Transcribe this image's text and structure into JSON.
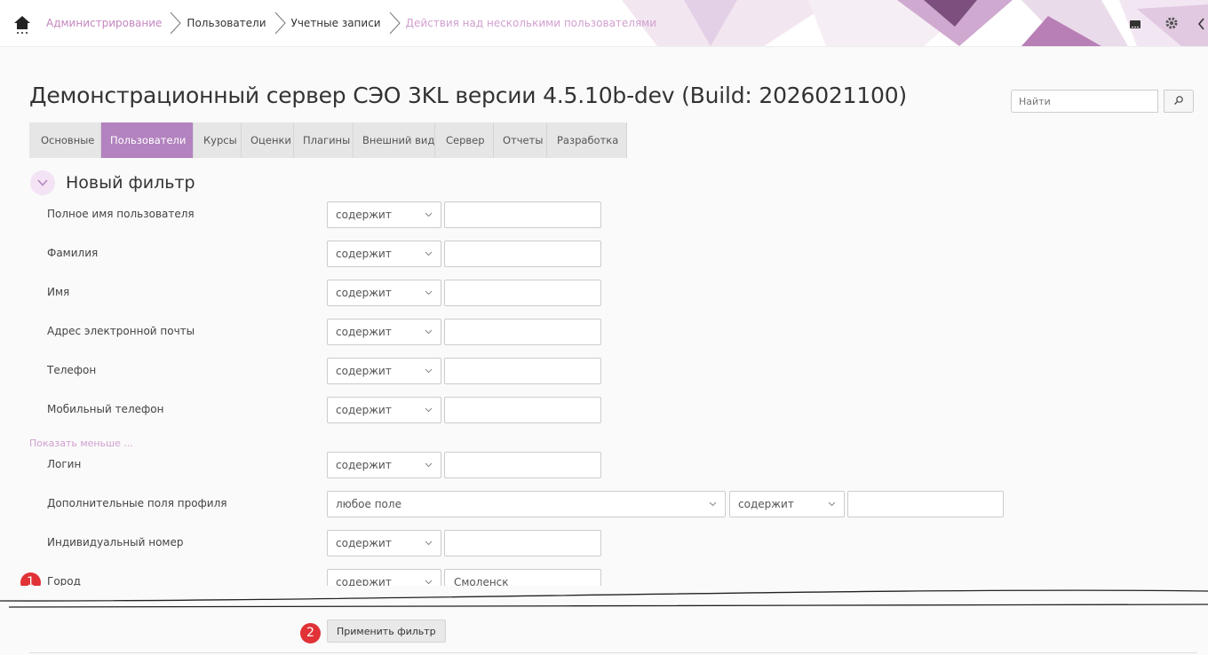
{
  "breadcrumbs": [
    {
      "label": "Администрирование",
      "style": "link"
    },
    {
      "label": "Пользователи",
      "style": "plain"
    },
    {
      "label": "Учетные записи",
      "style": "plain"
    },
    {
      "label": "Действия над несколькими пользователями",
      "style": "current"
    }
  ],
  "page_title": "Демонстрационный сервер СЭО 3KL версии 4.5.10b-dev (Build: 2026021100)",
  "search": {
    "placeholder": "Найти"
  },
  "tabs": [
    {
      "label": "Основные",
      "active": false
    },
    {
      "label": "Пользователи",
      "active": true
    },
    {
      "label": "Курсы",
      "active": false
    },
    {
      "label": "Оценки",
      "active": false
    },
    {
      "label": "Плагины",
      "active": false
    },
    {
      "label": "Внешний вид",
      "active": false
    },
    {
      "label": "Сервер",
      "active": false
    },
    {
      "label": "Отчеты",
      "active": false
    },
    {
      "label": "Разработка",
      "active": false
    }
  ],
  "filter": {
    "title": "Новый фильтр",
    "show_less": "Показать меньше ...",
    "operator": "содержит",
    "fields": [
      {
        "label": "Полное имя пользователя",
        "value": ""
      },
      {
        "label": "Фамилия",
        "value": ""
      },
      {
        "label": "Имя",
        "value": ""
      },
      {
        "label": "Адрес электронной почты",
        "value": ""
      },
      {
        "label": "Телефон",
        "value": ""
      },
      {
        "label": "Мобильный телефон",
        "value": ""
      },
      {
        "label": "Логин",
        "value": ""
      },
      {
        "label": "Дополнительные поля профиля",
        "field_select": "любое поле",
        "value": ""
      },
      {
        "label": "Индивидуальный номер",
        "value": ""
      },
      {
        "label": "Город",
        "value": "Смоленск"
      }
    ],
    "apply_label": "Применить фильтр"
  },
  "badges": [
    "1",
    "2"
  ],
  "colors": {
    "accent": "#b283be",
    "link": "#c586c0",
    "badge": "#e03237"
  },
  "icons": [
    "home-icon",
    "chevron-right-icon",
    "message-icon",
    "gear-icon",
    "chevron-left-icon",
    "search-icon",
    "chevron-down-icon"
  ]
}
